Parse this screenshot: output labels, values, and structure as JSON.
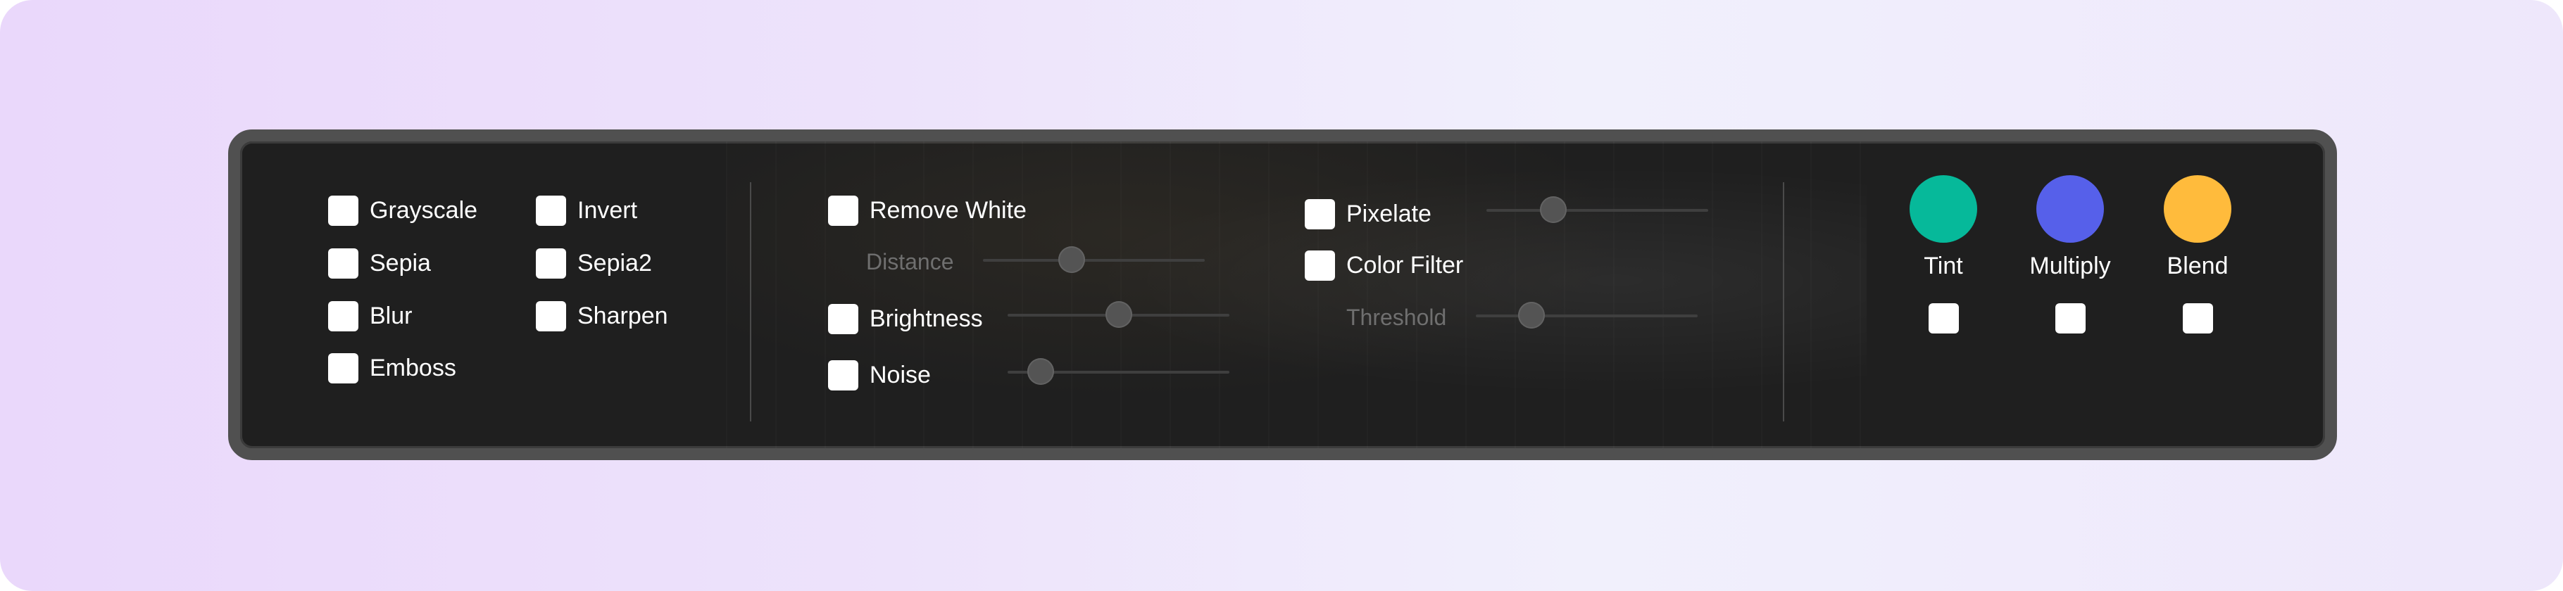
{
  "filters": {
    "grayscale": "Grayscale",
    "sepia": "Sepia",
    "blur": "Blur",
    "emboss": "Emboss",
    "invert": "Invert",
    "sepia2": "Sepia2",
    "sharpen": "Sharpen",
    "remove_white": "Remove White",
    "distance": "Distance",
    "brightness": "Brightness",
    "noise": "Noise",
    "pixelate": "Pixelate",
    "color_filter": "Color Filter",
    "threshold": "Threshold"
  },
  "slider_levels": {
    "distance": 0.4,
    "brightness": 0.5,
    "noise": 0.15,
    "pixelate": 0.3,
    "threshold": 0.25
  },
  "blend_modes": [
    {
      "label": "Tint",
      "color": "#06b99a",
      "icon": "color-swatch"
    },
    {
      "label": "Multiply",
      "color": "#5660ea",
      "icon": "color-swatch"
    },
    {
      "label": "Blend",
      "color": "#ffbb3c",
      "icon": "color-swatch"
    }
  ]
}
